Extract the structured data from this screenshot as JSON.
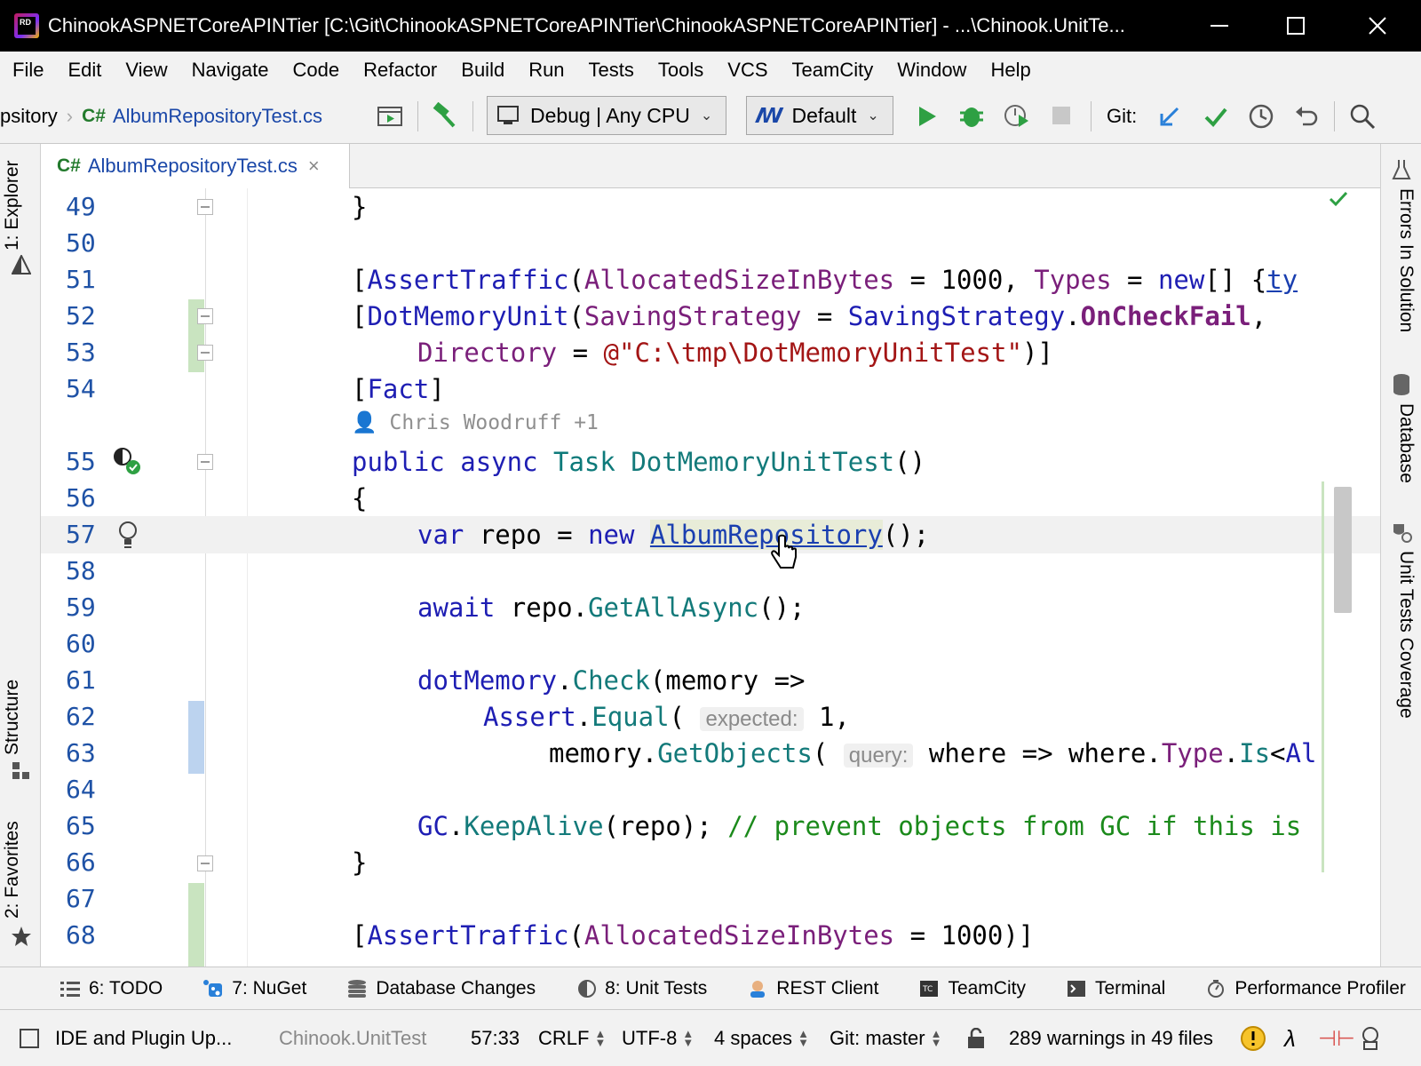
{
  "window": {
    "title": "ChinookASPNETCoreAPINTier [C:\\Git\\ChinookASPNETCoreAPINTier\\ChinookASPNETCoreAPINTier] - ...\\Chinook.UnitTe...",
    "logo_text": "RD"
  },
  "menu": [
    "File",
    "Edit",
    "View",
    "Navigate",
    "Code",
    "Refactor",
    "Build",
    "Run",
    "Tests",
    "Tools",
    "VCS",
    "TeamCity",
    "Window",
    "Help"
  ],
  "toolbar": {
    "breadcrumb_prev": "psitory",
    "breadcrumb_lang": "C#",
    "breadcrumb_file": "AlbumRepositoryTest.cs",
    "config": "Debug | Any CPU",
    "profile": "Default",
    "git_label": "Git:"
  },
  "left_tabs": {
    "explorer": "1: Explorer",
    "structure": "Structure",
    "favorites": "2: Favorites"
  },
  "right_tabs": {
    "errors": "Errors In Solution",
    "database": "Database",
    "coverage": "Unit Tests Coverage"
  },
  "editor_tab": {
    "lang": "C#",
    "name": "AlbumRepositoryTest.cs"
  },
  "code": {
    "lines": [
      {
        "n": "49",
        "html": "<span style='padding-left:350px'>}</span>"
      },
      {
        "n": "50",
        "html": ""
      },
      {
        "n": "51",
        "html": "<span style='padding-left:350px'>[<span class='attr'>AssertTraffic</span>(<span class='prop'>AllocatedSizeInBytes</span> = 1000, <span class='prop'>Types</span> = <span class='kw'>new</span>[] {<span class='link' style='background:none'>ty</span></span>"
      },
      {
        "n": "52",
        "html": "<span style='padding-left:350px'>[<span class='attr'>DotMemoryUnit</span>(<span class='prop'>SavingStrategy</span> = <span class='attr'>SavingStrategy</span>.<span class='bold-prop'>OnCheckFail</span>,</span>"
      },
      {
        "n": "53",
        "html": "<span style='padding-left:424px'><span class='prop'>Directory</span> = <span class='str'>@\"C:\\tmp\\DotMemoryUnitTest\"</span>)]</span>"
      },
      {
        "n": "54",
        "html": "<span style='padding-left:350px'>[<span class='attr'>Fact</span>]</span>"
      },
      {
        "n": "55",
        "html": "<span style='padding-left:350px'><span class='kw'>public</span> <span class='kw'>async</span> <span class='type'>Task</span> <span class='meth'>DotMemoryUnitTest</span>()</span>"
      },
      {
        "n": "56",
        "html": "<span style='padding-left:350px'>{</span>"
      },
      {
        "n": "57",
        "html": "<span style='padding-left:424px'><span class='kw'>var</span> repo = <span class='kw'>new</span> <span class='link'>AlbumRepository</span>();</span>"
      },
      {
        "n": "58",
        "html": ""
      },
      {
        "n": "59",
        "html": "<span style='padding-left:424px'><span class='kw'>await</span> repo.<span class='meth'>GetAllAsync</span>();</span>"
      },
      {
        "n": "60",
        "html": ""
      },
      {
        "n": "61",
        "html": "<span style='padding-left:424px'><span class='attr'>dotMemory</span>.<span class='meth'>Check</span>(memory =&gt;</span>"
      },
      {
        "n": "62",
        "html": "<span style='padding-left:498px'><span class='attr'>Assert</span>.<span class='meth'>Equal</span>( <span class='hint'>expected:</span> 1,</span>"
      },
      {
        "n": "63",
        "html": "<span style='padding-left:572px'>memory.<span class='meth'>GetObjects</span>( <span class='hint'>query:</span> where =&gt; where.<span class='prop'>Type</span>.<span class='meth'>Is</span>&lt;<span class='attr'>Al</span></span>"
      },
      {
        "n": "64",
        "html": ""
      },
      {
        "n": "65",
        "html": "<span style='padding-left:424px'><span class='attr'>GC</span>.<span class='meth'>KeepAlive</span>(repo); <span class='com'>// prevent objects from GC if this is</span></span>"
      },
      {
        "n": "66",
        "html": "<span style='padding-left:350px'>}</span>"
      },
      {
        "n": "67",
        "html": ""
      },
      {
        "n": "68",
        "html": "<span style='padding-left:350px'>[<span class='attr'>AssertTraffic</span>(<span class='prop'>AllocatedSizeInBytes</span> = 1000)]</span>"
      }
    ],
    "code_vision": "Chris Woodruff +1"
  },
  "toolwindows": [
    {
      "label": "6: TODO",
      "icon": "todo-icon"
    },
    {
      "label": "7: NuGet",
      "icon": "nuget-icon"
    },
    {
      "label": "Database Changes",
      "icon": "database-changes-icon"
    },
    {
      "label": "8: Unit Tests",
      "icon": "unit-tests-icon"
    },
    {
      "label": "REST Client",
      "icon": "rest-client-icon"
    },
    {
      "label": "TeamCity",
      "icon": "teamcity-icon"
    },
    {
      "label": "Terminal",
      "icon": "terminal-icon"
    },
    {
      "label": "Performance Profiler",
      "icon": "profiler-icon"
    }
  ],
  "status": {
    "update_msg": "IDE and Plugin Up...",
    "project": "Chinook.UnitTest",
    "position": "57:33",
    "line_sep": "CRLF",
    "encoding": "UTF-8",
    "indent": "4 spaces",
    "git_branch": "Git: master",
    "warnings": "289 warnings in 49 files"
  },
  "colors": {
    "accent_blue": "#1a47a8",
    "run_green": "#2ea043",
    "titlebar": "#000000"
  }
}
